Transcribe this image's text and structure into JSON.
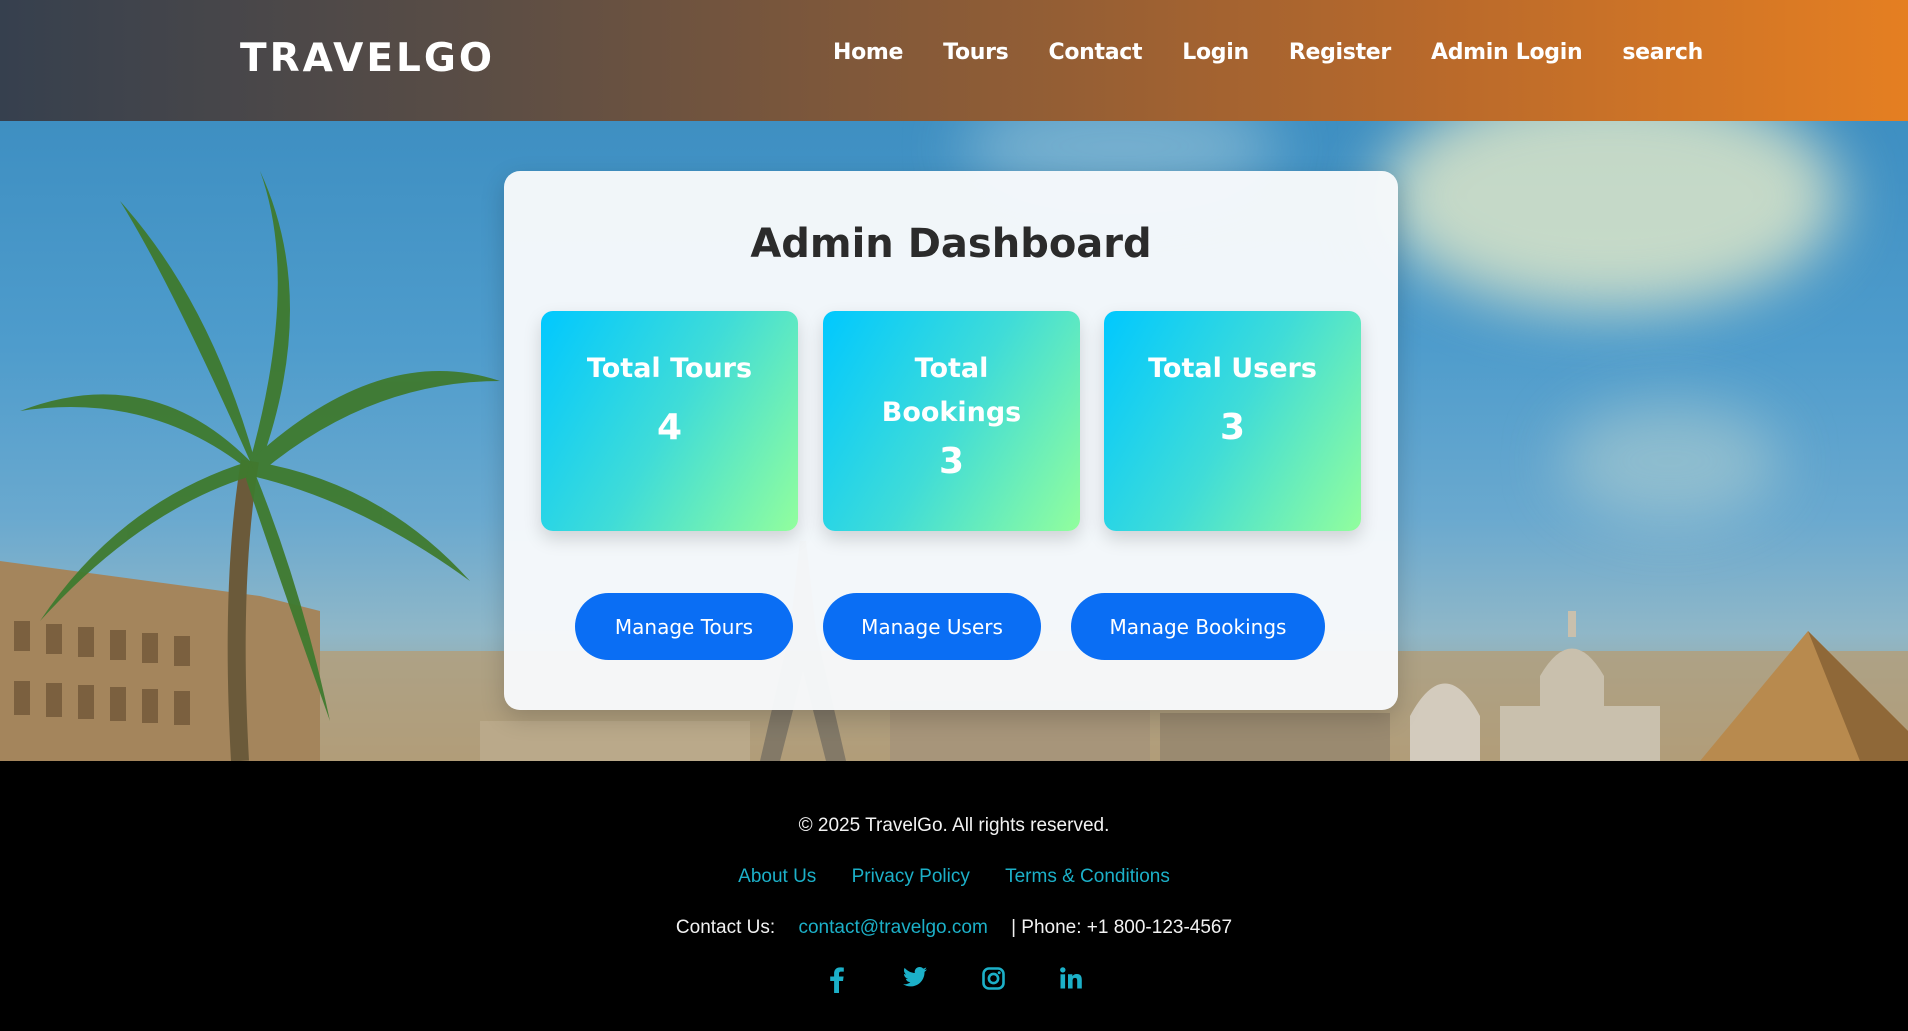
{
  "header": {
    "logo": "TRAVELGO",
    "nav": [
      "Home",
      "Tours",
      "Contact",
      "Login",
      "Register",
      "Admin Login",
      "search"
    ]
  },
  "dashboard": {
    "title": "Admin Dashboard",
    "stats": [
      {
        "label": "Total Tours",
        "value": "4"
      },
      {
        "label": "Total Bookings",
        "value": "3"
      },
      {
        "label": "Total Users",
        "value": "3"
      }
    ],
    "buttons": [
      "Manage Tours",
      "Manage Users",
      "Manage Bookings"
    ]
  },
  "footer": {
    "copyright": "© 2025 TravelGo. All rights reserved.",
    "links": [
      "About Us",
      "Privacy Policy",
      "Terms & Conditions"
    ],
    "contact_label": "Contact Us:",
    "email": "contact@travelgo.com",
    "phone": "| Phone: +1 800-123-4567",
    "social": [
      "facebook-icon",
      "twitter-icon",
      "instagram-icon",
      "linkedin-icon"
    ]
  },
  "colors": {
    "header_start": "#36404e",
    "header_end": "#e57f22",
    "button": "#0a6ef4",
    "stat_gradient_start": "#00c8ff",
    "stat_gradient_end": "#92fe9d",
    "footer_link": "#1cb0c8"
  }
}
